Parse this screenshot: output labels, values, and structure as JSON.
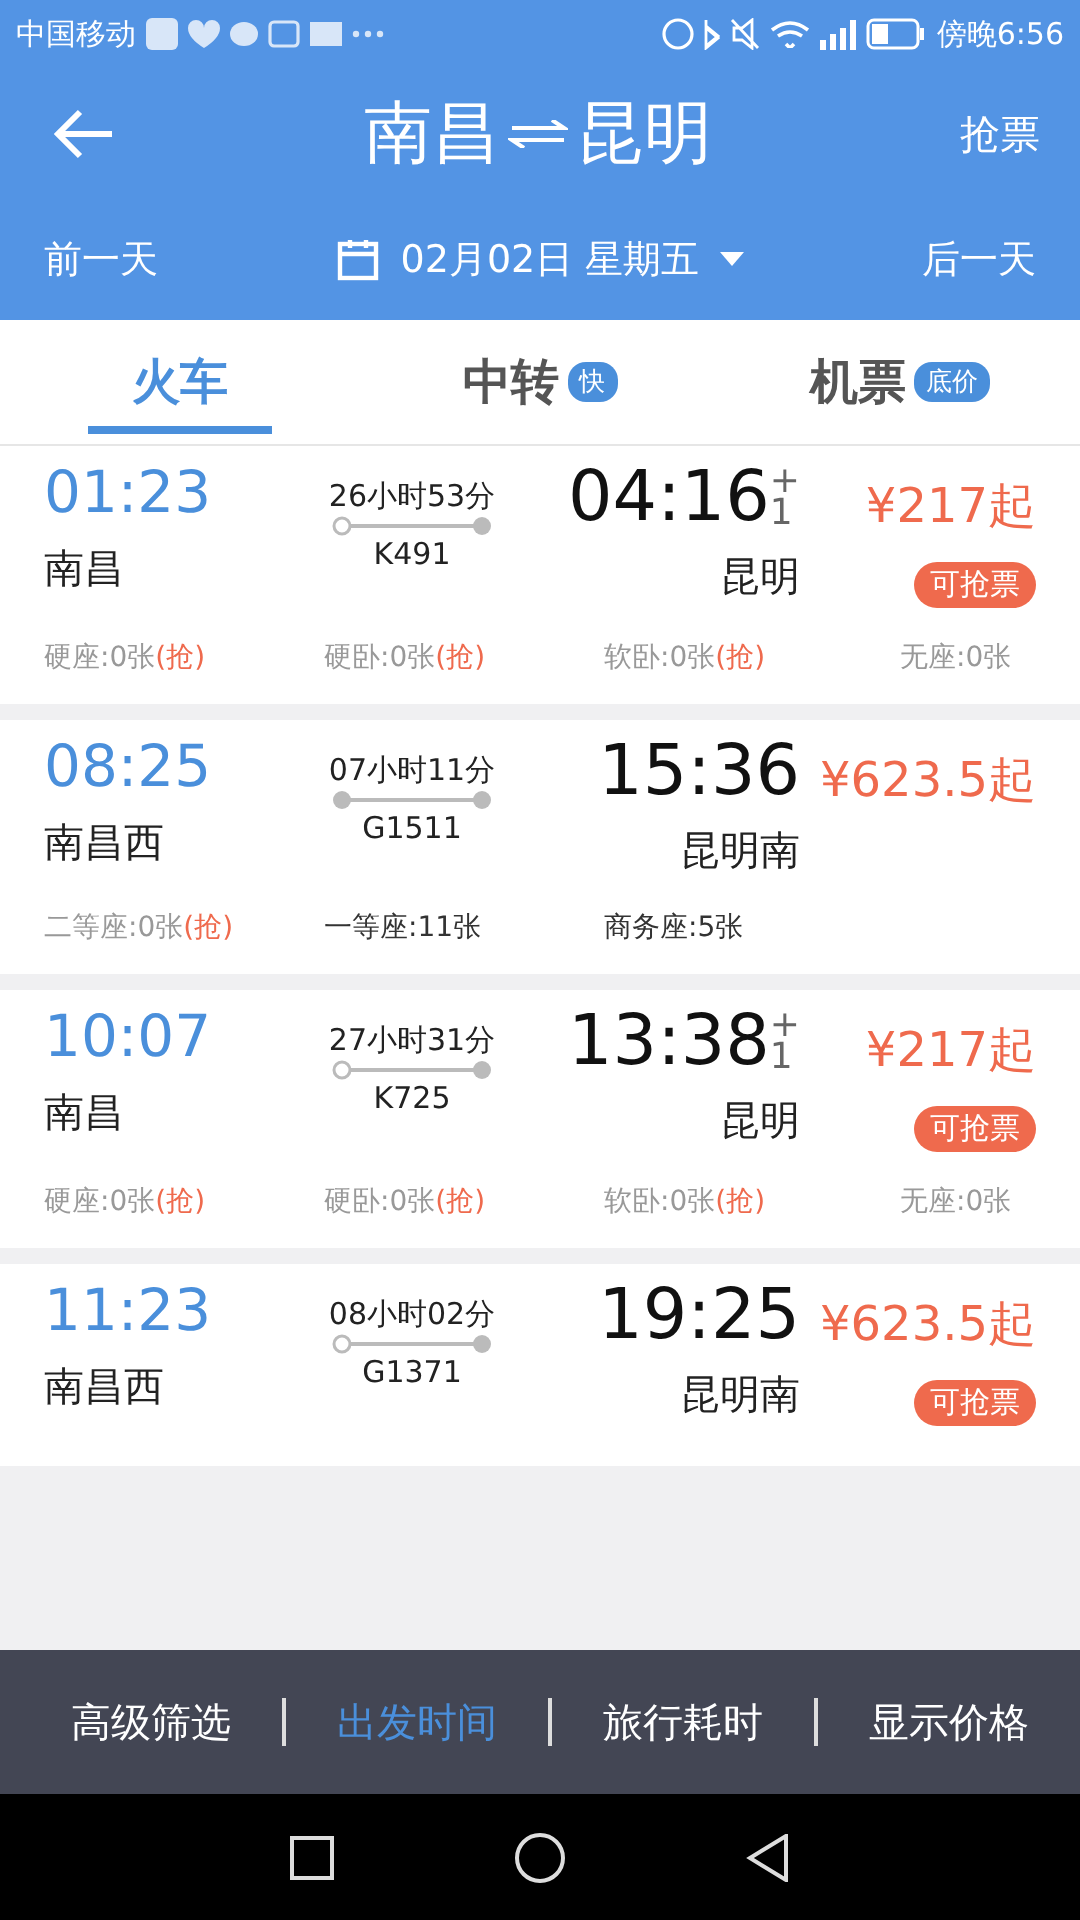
{
  "status_bar": {
    "carrier": "中国移动",
    "time": "傍晚6:56"
  },
  "header": {
    "title_from": "南昌",
    "title_to": "昆明",
    "action": "抢票"
  },
  "date_bar": {
    "prev": "前一天",
    "date": "02月02日 星期五",
    "next": "后一天"
  },
  "tabs": [
    {
      "label": "火车",
      "selected": true
    },
    {
      "label": "中转",
      "badge": "快",
      "selected": false
    },
    {
      "label": "机票",
      "badge": "底价",
      "selected": false
    }
  ],
  "trains": [
    {
      "depart": "01:23",
      "from": "南昌",
      "duration": "26小时53分",
      "starts_here": true,
      "number": "K491",
      "arrive": "04:16",
      "next_day_sign": "+",
      "next_day_count": "1",
      "to": "昆明",
      "price": "¥217起",
      "grab_badge": "可抢票",
      "seats": [
        {
          "label": "硬座:0张",
          "grab": "(抢)",
          "available": false
        },
        {
          "label": "硬卧:0张",
          "grab": "(抢)",
          "available": false
        },
        {
          "label": "软卧:0张",
          "grab": "(抢)",
          "available": false
        },
        {
          "label": "无座:0张",
          "available": false
        }
      ]
    },
    {
      "depart": "08:25",
      "from": "南昌西",
      "duration": "07小时11分",
      "starts_here": false,
      "number": "G1511",
      "arrive": "15:36",
      "to": "昆明南",
      "price": "¥623.5起",
      "seats": [
        {
          "label": "二等座:0张",
          "grab": "(抢)",
          "available": false
        },
        {
          "label": "一等座:11张",
          "available": true
        },
        {
          "label": "商务座:5张",
          "available": true
        }
      ]
    },
    {
      "depart": "10:07",
      "from": "南昌",
      "duration": "27小时31分",
      "starts_here": true,
      "number": "K725",
      "arrive": "13:38",
      "next_day_sign": "+",
      "next_day_count": "1",
      "to": "昆明",
      "price": "¥217起",
      "grab_badge": "可抢票",
      "seats": [
        {
          "label": "硬座:0张",
          "grab": "(抢)",
          "available": false
        },
        {
          "label": "硬卧:0张",
          "grab": "(抢)",
          "available": false
        },
        {
          "label": "软卧:0张",
          "grab": "(抢)",
          "available": false
        },
        {
          "label": "无座:0张",
          "available": false
        }
      ]
    },
    {
      "depart": "11:23",
      "from": "南昌西",
      "duration": "08小时02分",
      "starts_here": true,
      "number": "G1371",
      "arrive": "19:25",
      "to": "昆明南",
      "price": "¥623.5起",
      "grab_badge": "可抢票"
    }
  ],
  "filter_bar": [
    {
      "label": "高级筛选",
      "selected": false
    },
    {
      "label": "出发时间",
      "selected": true
    },
    {
      "label": "旅行耗时",
      "selected": false
    },
    {
      "label": "显示价格",
      "selected": false
    }
  ]
}
